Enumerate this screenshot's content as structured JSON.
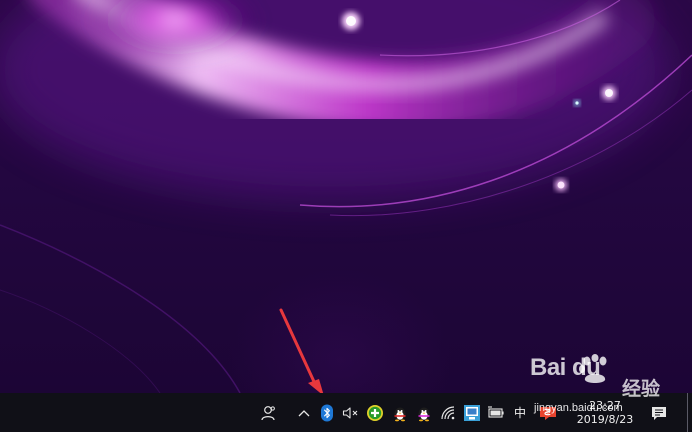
{
  "wallpaper": {
    "palette": {
      "background": "#230740",
      "glow": "#e046e6",
      "highlight": "#f3b8f7"
    }
  },
  "annotation": {
    "arrow_color": "#e8383d",
    "points_to": "bluetooth-tray-icon"
  },
  "taskbar": {
    "background": "#101017",
    "people_icon": "people-icon",
    "tray": {
      "overflow_icon": "chevron-up-icon",
      "icons": [
        "bluetooth-icon",
        "speaker-muted-icon",
        "360-security-icon",
        "qq-penguin-icon",
        "qq-penguin-icon",
        "wifi-icon",
        "network-adapter-icon",
        "battery-icon"
      ],
      "ime": "中",
      "antivirus_icon": "sogou-input-icon"
    },
    "clock": {
      "time": "23:27",
      "date": "2019/8/23"
    },
    "notification_icon": "action-center-icon"
  },
  "watermark": {
    "logo": "Bai du",
    "jingyan": "经验",
    "site": "jingyan.baidu.com"
  }
}
